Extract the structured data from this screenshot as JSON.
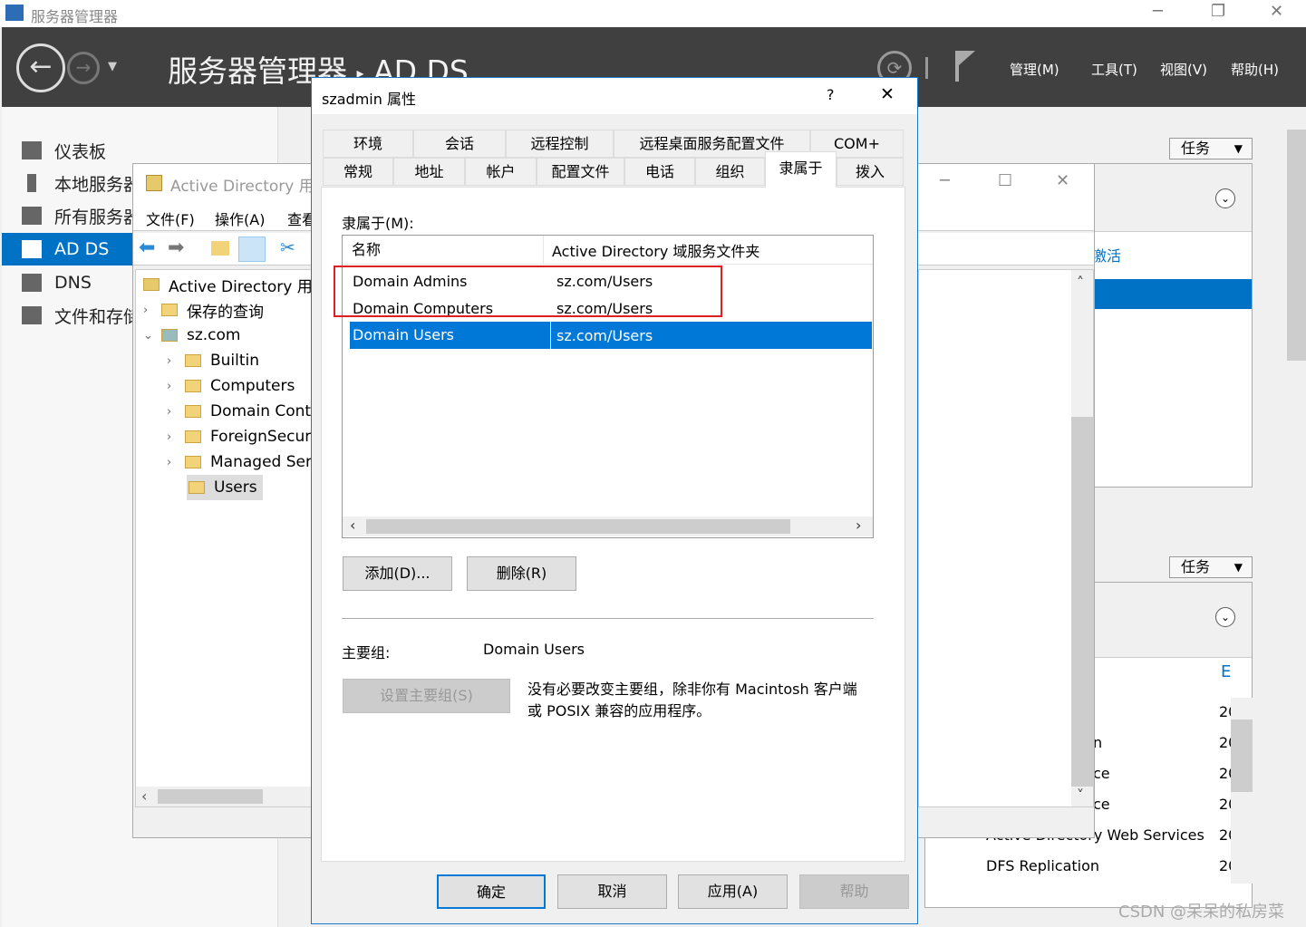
{
  "window": {
    "title": "服务器管理器",
    "controls": [
      "minimize",
      "restore",
      "close"
    ]
  },
  "header": {
    "breadcrumb_root": "服务器管理器",
    "breadcrumb_sep": "▸",
    "breadcrumb_page": "AD DS",
    "menus": [
      "管理(M)",
      "工具(T)",
      "视图(V)",
      "帮助(H)"
    ]
  },
  "sidebar": {
    "items": [
      {
        "label": "仪表板",
        "icon": "dashboard-icon"
      },
      {
        "label": "本地服务器",
        "icon": "local-server-icon"
      },
      {
        "label": "所有服务器",
        "icon": "all-servers-icon"
      },
      {
        "label": "AD DS",
        "icon": "ad-ds-icon",
        "selected": true
      },
      {
        "label": "DNS",
        "icon": "dns-icon"
      },
      {
        "label": "文件和存储服务",
        "icon": "file-storage-icon"
      }
    ]
  },
  "right": {
    "tasks_label": "任务",
    "panel1_tab": "激活",
    "panel2_col": "E",
    "services": [
      "n",
      "ce",
      "ce",
      "Active Directory Web Services",
      "DFS Replication"
    ],
    "col_value": "20"
  },
  "mmc": {
    "title": "Active Directory 用户和计算机",
    "menus": [
      "文件(F)",
      "操作(A)",
      "查看(V)"
    ],
    "tree": {
      "root": "Active Directory 用户和计算机",
      "saved": "保存的查询",
      "domain": "sz.com",
      "children": [
        "Builtin",
        "Computers",
        "Domain Controllers",
        "ForeignSecurityPrincipals",
        "Managed Service Accounts",
        "Users"
      ],
      "selected": "Users"
    }
  },
  "dialog": {
    "title": "szadmin 属性",
    "help": "?",
    "close": "✕",
    "tabs_row1": [
      "环境",
      "会话",
      "远程控制",
      "远程桌面服务配置文件",
      "COM+"
    ],
    "tabs_row2": [
      "常规",
      "地址",
      "帐户",
      "配置文件",
      "电话",
      "组织",
      "隶属于",
      "拨入"
    ],
    "selected_tab": "隶属于",
    "member_of_label": "隶属于(M):",
    "columns": [
      "名称",
      "Active Directory 域服务文件夹"
    ],
    "rows": [
      {
        "name": "Domain Admins",
        "folder": "sz.com/Users"
      },
      {
        "name": "Domain Computers",
        "folder": "sz.com/Users"
      },
      {
        "name": "Domain Users",
        "folder": "sz.com/Users",
        "selected": true
      }
    ],
    "highlight_color": "#e02020",
    "add_label": "添加(D)...",
    "remove_label": "删除(R)",
    "primary_group_label": "主要组:",
    "primary_group_value": "Domain Users",
    "set_primary_label": "设置主要组(S)",
    "note": "没有必要改变主要组，除非你有 Macintosh 客户端或 POSIX 兼容的应用程序。",
    "ok_label": "确定",
    "cancel_label": "取消",
    "apply_label": "应用(A)",
    "help_label": "帮助"
  },
  "watermark": "CSDN @呆呆的私房菜",
  "colors": {
    "accent": "#0072c6",
    "header": "#404040",
    "selection": "#0078d7"
  }
}
